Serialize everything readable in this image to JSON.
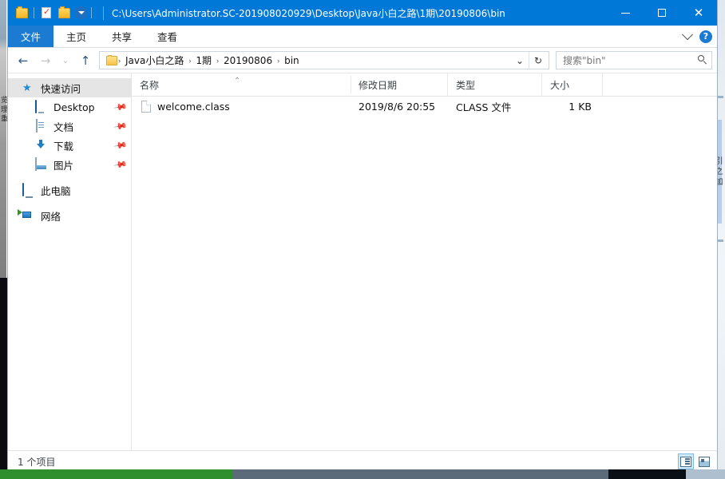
{
  "window": {
    "title": "C:\\Users\\Administrator.SC-201908020929\\Desktop\\Java小白之路\\1期\\20190806\\bin",
    "minimize_label": "最小化",
    "maximize_label": "最大化",
    "close_label": "关闭"
  },
  "quick_access_toolbar": {
    "items": [
      {
        "name": "folder-icon",
        "label": "文件夹"
      },
      {
        "name": "properties-icon",
        "label": "属性"
      },
      {
        "name": "new-folder-icon",
        "label": "新建文件夹"
      }
    ],
    "customize_label": "自定义快速访问工具栏"
  },
  "ribbon": {
    "tabs": [
      {
        "label": "文件",
        "active": true
      },
      {
        "label": "主页",
        "active": false
      },
      {
        "label": "共享",
        "active": false
      },
      {
        "label": "查看",
        "active": false
      }
    ],
    "expand_label": "展开功能区",
    "help_label": "?"
  },
  "navigation": {
    "back_label": "←",
    "forward_label": "→",
    "recent_label": "⌄",
    "up_label": "↑",
    "refresh_label": "↻",
    "dropdown_label": "⌄"
  },
  "breadcrumb": {
    "separator": "›",
    "items": [
      "Java小白之路",
      "1期",
      "20190806",
      "bin"
    ]
  },
  "search": {
    "placeholder": "搜索\"bin\"",
    "icon": "search-icon"
  },
  "sidebar": {
    "items": [
      {
        "label": "快速访问",
        "icon": "pin-star-icon",
        "level": "root",
        "selected": true,
        "pinned": false
      },
      {
        "label": "Desktop",
        "icon": "desktop-icon",
        "level": "child",
        "selected": false,
        "pinned": true
      },
      {
        "label": "文档",
        "icon": "documents-icon",
        "level": "child",
        "selected": false,
        "pinned": true
      },
      {
        "label": "下载",
        "icon": "downloads-icon",
        "level": "child",
        "selected": false,
        "pinned": true
      },
      {
        "label": "图片",
        "icon": "pictures-icon",
        "level": "child",
        "selected": false,
        "pinned": true
      },
      {
        "label": "此电脑",
        "icon": "this-pc-icon",
        "level": "root",
        "selected": false,
        "pinned": false
      },
      {
        "label": "网络",
        "icon": "network-icon",
        "level": "root",
        "selected": false,
        "pinned": false
      }
    ],
    "pin_glyph": "📌"
  },
  "file_list": {
    "columns": [
      {
        "key": "name",
        "label": "名称",
        "sorted": "asc",
        "sort_glyph": "⌃"
      },
      {
        "key": "date",
        "label": "修改日期",
        "sorted": "",
        "sort_glyph": ""
      },
      {
        "key": "type",
        "label": "类型",
        "sorted": "",
        "sort_glyph": ""
      },
      {
        "key": "size",
        "label": "大小",
        "sorted": "",
        "sort_glyph": ""
      }
    ],
    "rows": [
      {
        "icon": "generic-file-icon",
        "name": "welcome.class",
        "date": "2019/8/6 20:55",
        "type": "CLASS 文件",
        "size": "1 KB"
      }
    ]
  },
  "status_bar": {
    "item_count_text": "1 个项目",
    "views": [
      {
        "name": "details-view-button",
        "label": "详细信息",
        "active": true
      },
      {
        "name": "large-icons-view-button",
        "label": "大图标",
        "active": false
      }
    ]
  },
  "background": {
    "left_text": "览 理 重",
    "right_text": "引 之 加"
  },
  "colors": {
    "title_bar": "#0078d7",
    "file_tab": "#1b7ad1",
    "selection": "#e5e5e5",
    "view_active": "#cde8f7",
    "accent_folder": "#fcc63f"
  }
}
